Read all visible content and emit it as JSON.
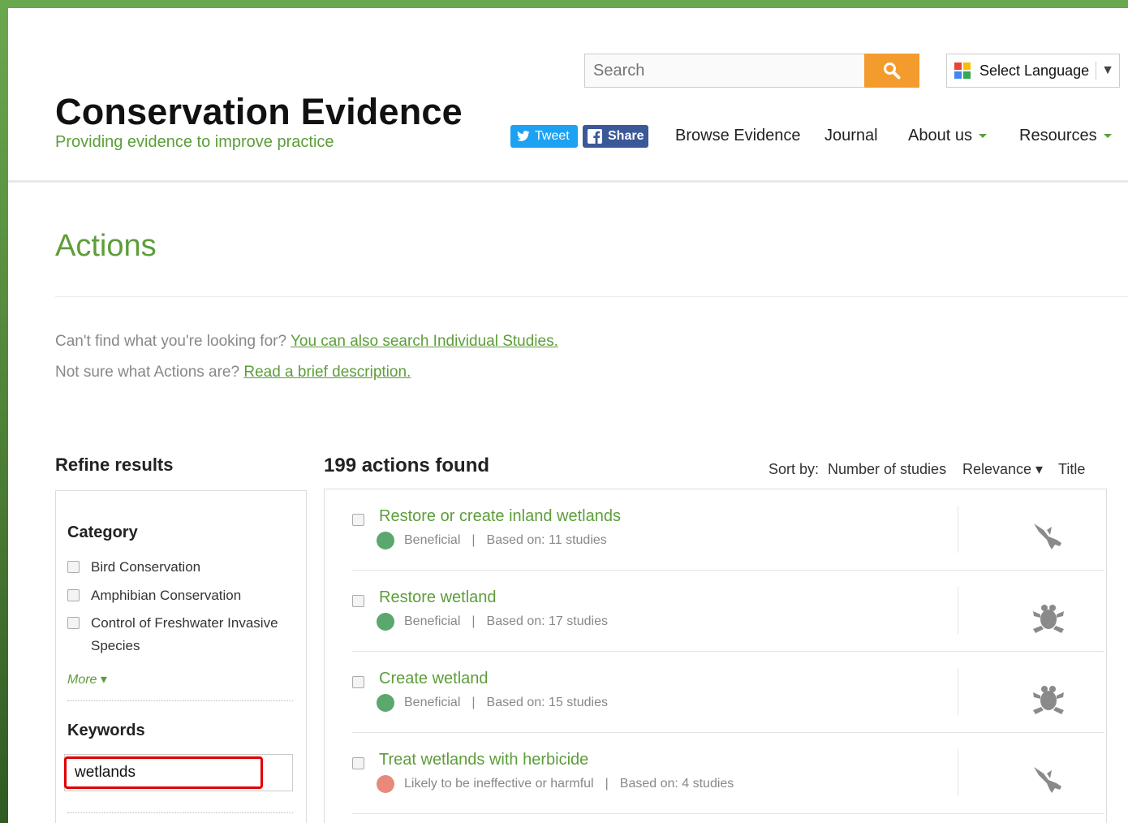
{
  "header": {
    "title": "Conservation Evidence",
    "tagline": "Providing evidence to improve practice",
    "search_placeholder": "Search",
    "language_label": "Select Language",
    "tweet_label": "Tweet",
    "share_label": "Share",
    "nav": [
      {
        "label": "Browse Evidence",
        "dropdown": false
      },
      {
        "label": "Journal",
        "dropdown": false
      },
      {
        "label": "About us",
        "dropdown": true
      },
      {
        "label": "Resources",
        "dropdown": true
      }
    ]
  },
  "page": {
    "title": "Actions",
    "intro_1_text": "Can't find what you're looking for?",
    "intro_1_link": "You can also search Individual Studies.",
    "intro_2_text": "Not sure what Actions are?",
    "intro_2_link": "Read a brief description."
  },
  "sidebar": {
    "title": "Refine results",
    "category_heading": "Category",
    "categories": [
      "Bird Conservation",
      "Amphibian Conservation",
      "Control of Freshwater Invasive Species"
    ],
    "more_label": "More ▾",
    "keywords_heading": "Keywords",
    "keywords_value": "wetlands"
  },
  "results": {
    "count_label": "199 actions found",
    "sort_by_label": "Sort by:",
    "sort_options": [
      "Number of studies",
      "Relevance ▾",
      "Title"
    ],
    "items": [
      {
        "title": "Restore or create inland wetlands",
        "effectiveness": "Beneficial",
        "based_on": "Based on: 11 studies",
        "color": "#5aa86e",
        "icon": "bird-icon"
      },
      {
        "title": "Restore wetland",
        "effectiveness": "Beneficial",
        "based_on": "Based on: 17 studies",
        "color": "#5aa86e",
        "icon": "frog-icon"
      },
      {
        "title": "Create wetland",
        "effectiveness": "Beneficial",
        "based_on": "Based on: 15 studies",
        "color": "#5aa86e",
        "icon": "frog-icon"
      },
      {
        "title": "Treat wetlands with herbicide",
        "effectiveness": "Likely to be ineffective or harmful",
        "based_on": "Based on: 4 studies",
        "color": "#e8897a",
        "icon": "bird-icon"
      }
    ]
  },
  "colors": {
    "brand_green": "#5d9d3a",
    "search_orange": "#f39c2d",
    "highlight_red": "#e00000"
  }
}
